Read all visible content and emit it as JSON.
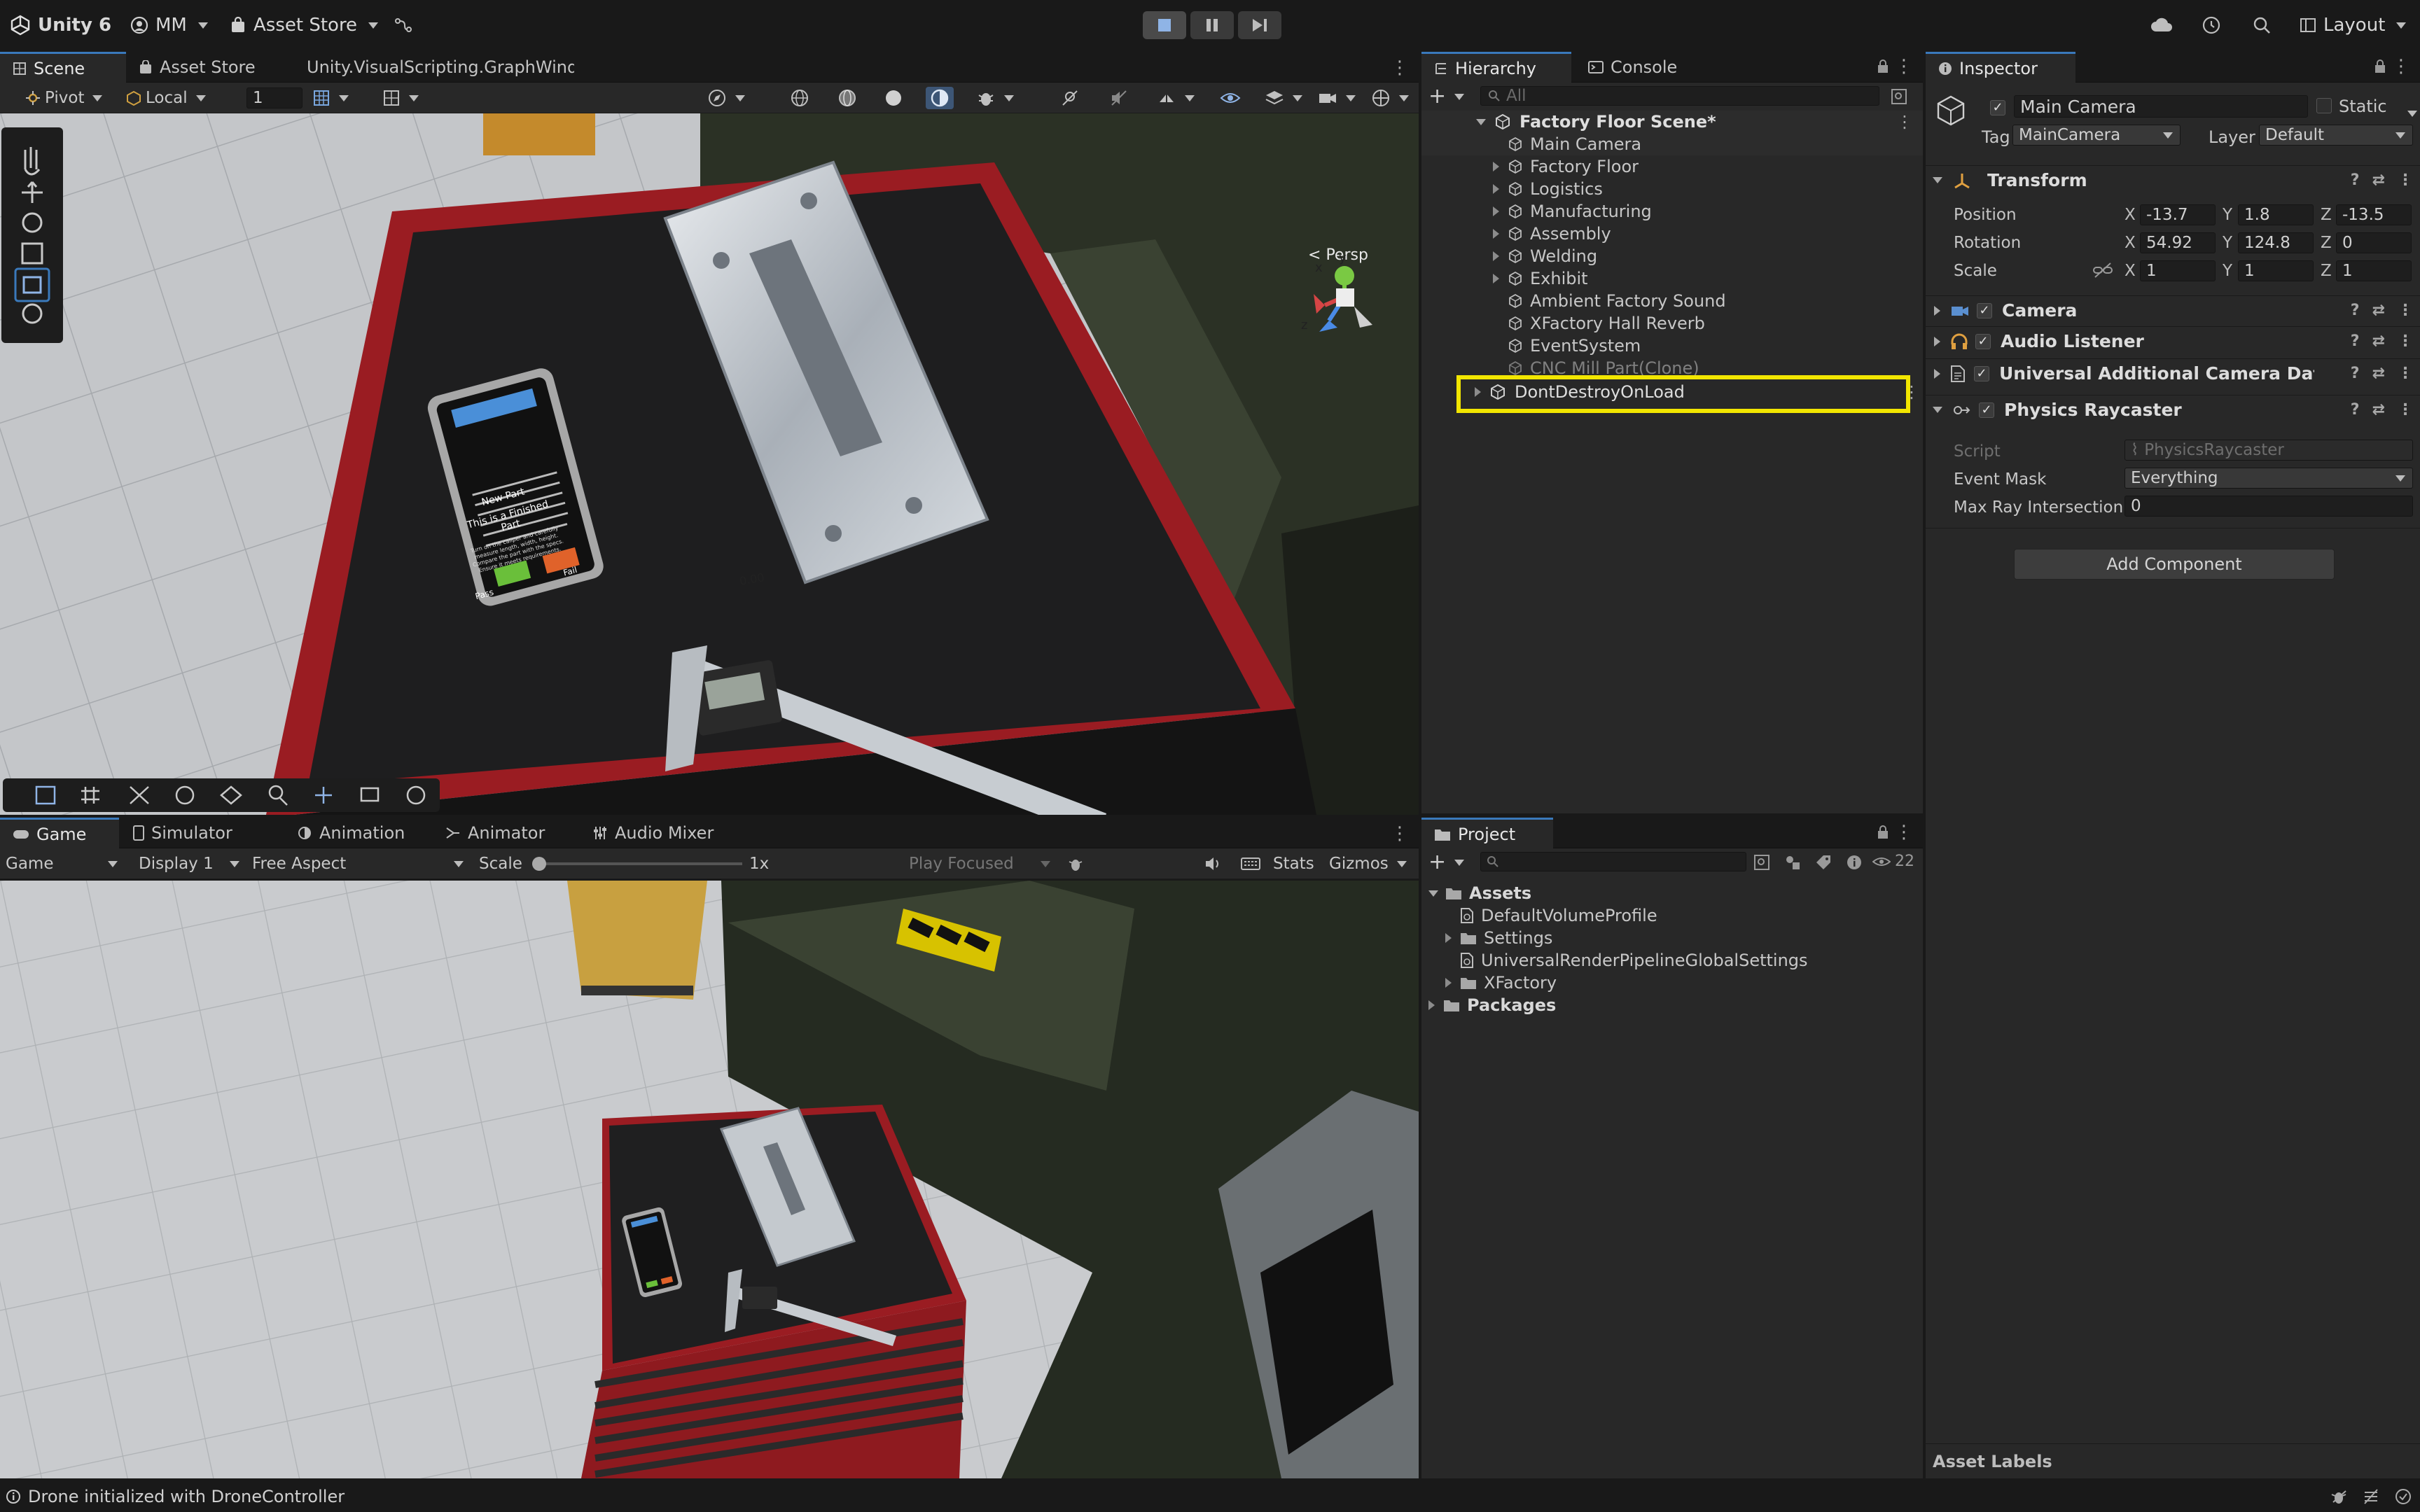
{
  "topbar": {
    "app": "Unity 6",
    "account": "MM",
    "asset_store": "Asset Store",
    "layout": "Layout"
  },
  "scene_panel": {
    "tabs": [
      "Scene",
      "Asset Store",
      "Unity.VisualScripting.GraphWindc"
    ],
    "pivot": "Pivot",
    "local": "Local",
    "grid_value": "1",
    "persp": "Persp",
    "gizmo_axes": {
      "x": "x",
      "y": "y",
      "z": "z"
    }
  },
  "tablet_ui": {
    "button_top": "New Part",
    "title": "This is a Finished Part",
    "body": "Turn on the caliper and carefully measure length, width, height. Compare the part with the specs. Ensure it meets requirements.",
    "pass": "Pass",
    "fail": "Fail"
  },
  "caliper_reading": "0.00",
  "game_panel": {
    "tabs": [
      "Game",
      "Simulator",
      "Animation",
      "Animator",
      "Audio Mixer"
    ],
    "mode": "Game",
    "display": "Display 1",
    "aspect": "Free Aspect",
    "scale_label": "Scale",
    "scale_value": "1x",
    "play_focused": "Play Focused",
    "stats": "Stats",
    "gizmos": "Gizmos"
  },
  "hierarchy": {
    "tabs": [
      "Hierarchy",
      "Console"
    ],
    "search_placeholder": "All",
    "scene_name": "Factory Floor Scene*",
    "items": [
      {
        "label": "Main Camera",
        "expandable": false
      },
      {
        "label": "Factory Floor",
        "expandable": true
      },
      {
        "label": "Logistics",
        "expandable": true
      },
      {
        "label": "Manufacturing",
        "expandable": true
      },
      {
        "label": "Assembly",
        "expandable": true
      },
      {
        "label": "Welding",
        "expandable": true
      },
      {
        "label": "Exhibit",
        "expandable": true
      },
      {
        "label": "Ambient Factory Sound",
        "expandable": false
      },
      {
        "label": "XFactory Hall Reverb",
        "expandable": false
      },
      {
        "label": "EventSystem",
        "expandable": false
      },
      {
        "label": "CNC Mill Part(Clone)",
        "expandable": false
      }
    ],
    "dont_destroy": "DontDestroyOnLoad",
    "highlight_color": "#f2e600"
  },
  "inspector": {
    "tab": "Inspector",
    "object_name": "Main Camera",
    "static_label": "Static",
    "tag_label": "Tag",
    "tag_value": "MainCamera",
    "layer_label": "Layer",
    "layer_value": "Default",
    "transform": {
      "title": "Transform",
      "position_label": "Position",
      "rotation_label": "Rotation",
      "scale_label": "Scale",
      "position": {
        "x": "-13.7",
        "y": "1.8",
        "z": "-13.5"
      },
      "rotation": {
        "x": "54.92",
        "y": "124.8",
        "z": "0"
      },
      "scale": {
        "x": "1",
        "y": "1",
        "z": "1"
      }
    },
    "components": [
      "Camera",
      "Audio Listener",
      "Universal Additional Camera Data (Scri",
      "Physics Raycaster"
    ],
    "raycaster": {
      "script_label": "Script",
      "script_value": "PhysicsRaycaster",
      "event_mask_label": "Event Mask",
      "event_mask_value": "Everything",
      "max_ray_label": "Max Ray Intersection",
      "max_ray_value": "0"
    },
    "add_component": "Add Component",
    "asset_labels": "Asset Labels"
  },
  "project": {
    "tab": "Project",
    "count": "22",
    "tree": [
      {
        "label": "Assets",
        "level": 0,
        "type": "folder-open",
        "bold": true
      },
      {
        "label": "DefaultVolumeProfile",
        "level": 1,
        "type": "asset",
        "bold": false
      },
      {
        "label": "Settings",
        "level": 1,
        "type": "folder",
        "bold": false
      },
      {
        "label": "UniversalRenderPipelineGlobalSettings",
        "level": 1,
        "type": "asset",
        "bold": false
      },
      {
        "label": "XFactory",
        "level": 1,
        "type": "folder",
        "bold": false
      },
      {
        "label": "Packages",
        "level": 0,
        "type": "folder",
        "bold": true
      }
    ]
  },
  "status_bar": {
    "message": "Drone initialized with DroneController"
  },
  "colors": {
    "panel": "#282828",
    "bg": "#191919",
    "accent": "#3a79bb",
    "tablet_pass": "#6abf3a",
    "tablet_fail": "#e0622a",
    "tablet_new_part": "#4a8fd8"
  }
}
